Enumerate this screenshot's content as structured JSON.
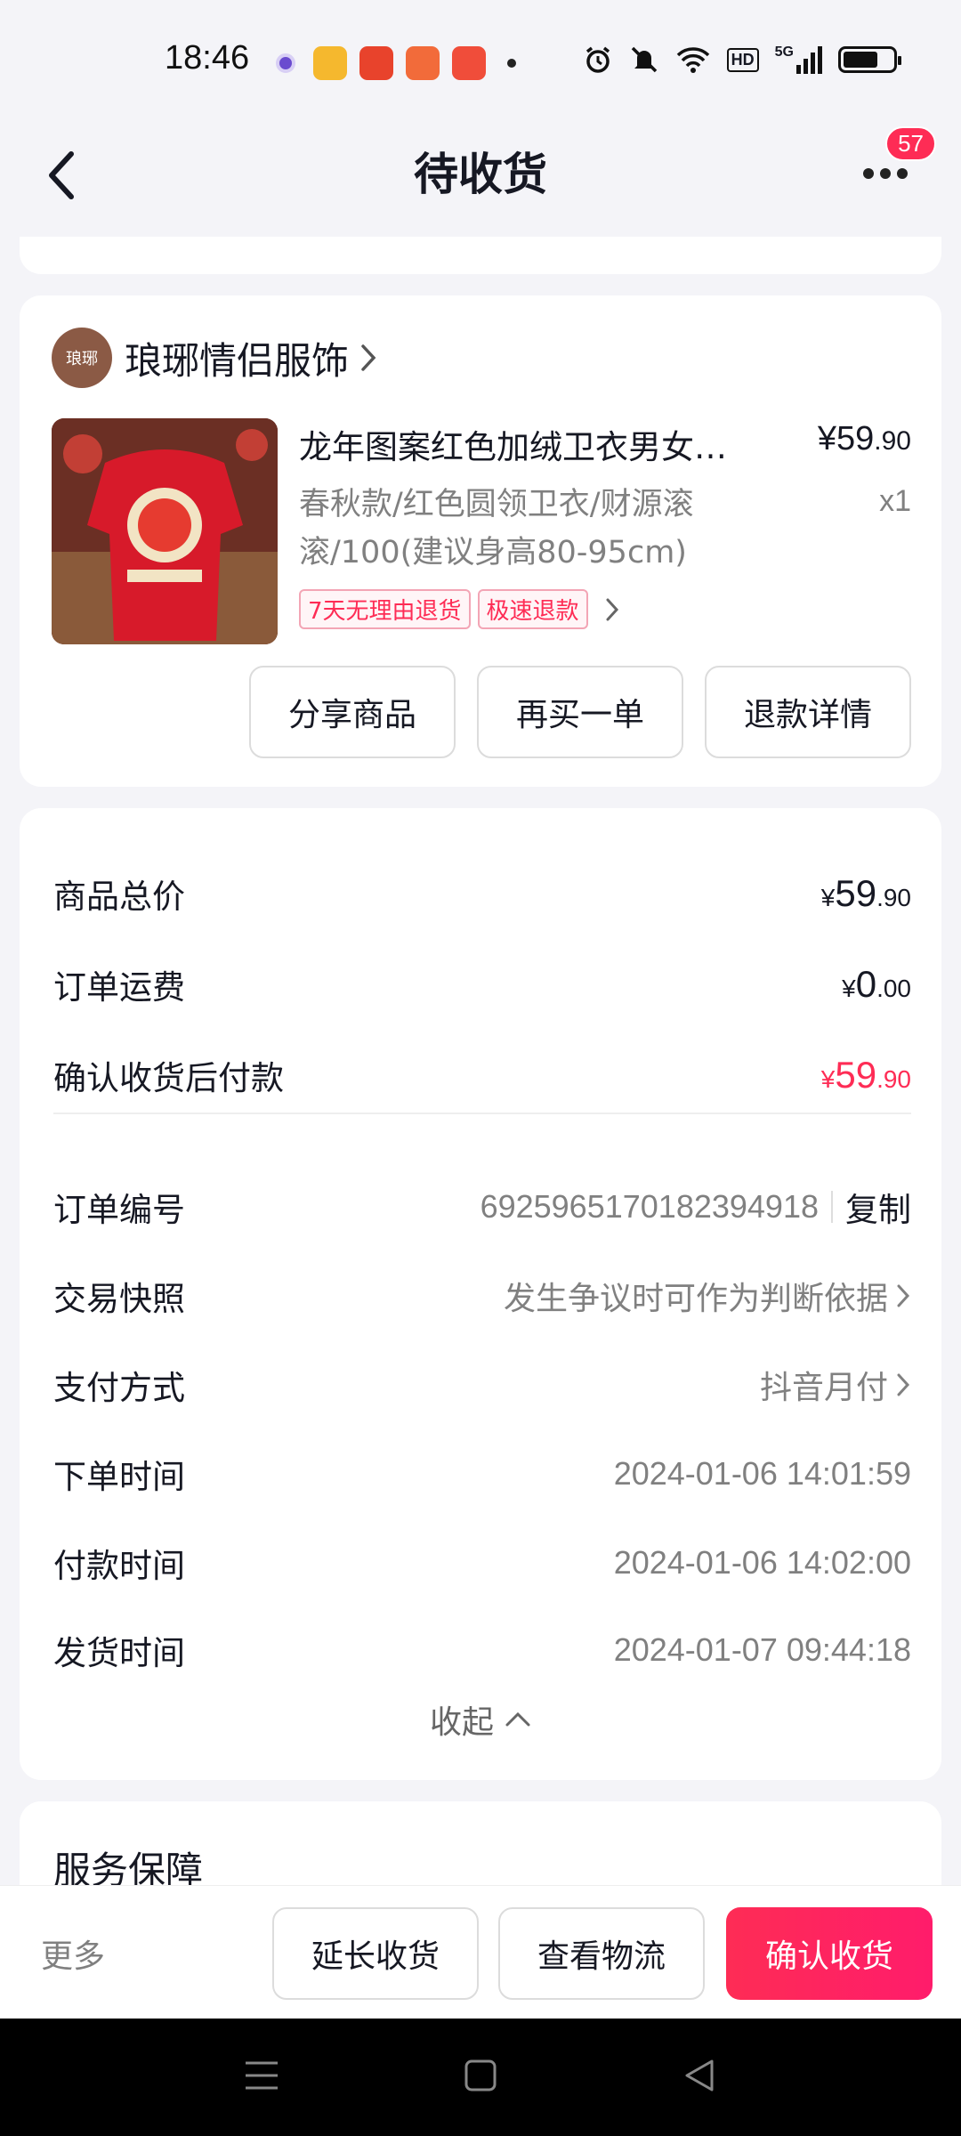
{
  "status_bar": {
    "time": "18:46",
    "network_label": "5G",
    "hd_label": "HD",
    "battery_level": 0.7
  },
  "nav": {
    "title": "待收货",
    "badge_count": "57"
  },
  "shop": {
    "logo_text": "琅琊",
    "name": "琅琊情侣服饰"
  },
  "product": {
    "title": "龙年图案红色加绒卫衣男女…",
    "price_symbol": "¥",
    "price_int": "59",
    "price_dec": ".90",
    "sku": "春秋款/红色圆领卫衣/财源滚滚/100(建议身高80-95cm)",
    "qty": "x1",
    "tags": [
      "7天无理由退货",
      "极速退款"
    ],
    "actions": [
      "分享商品",
      "再买一单",
      "退款详情"
    ]
  },
  "price_rows": [
    {
      "label": "商品总价",
      "cur": "¥",
      "int": "59",
      "dec": ".90"
    },
    {
      "label": "订单运费",
      "cur": "¥",
      "int": "0",
      "dec": ".00"
    },
    {
      "label": "确认收货后付款",
      "cur": "¥",
      "int": "59",
      "dec": ".90"
    }
  ],
  "order_info": {
    "order_no_label": "订单编号",
    "order_no": "6925965170182394918",
    "copy_label": "复制",
    "snapshot_label": "交易快照",
    "snapshot_value": "发生争议时可作为判断依据",
    "payment_label": "支付方式",
    "payment_value": "抖音月付",
    "order_time_label": "下单时间",
    "order_time": "2024-01-06 14:01:59",
    "pay_time_label": "付款时间",
    "pay_time": "2024-01-06 14:02:00",
    "ship_time_label": "发货时间",
    "ship_time": "2024-01-07 09:44:18",
    "collapse_label": "收起"
  },
  "service": {
    "title": "服务保障"
  },
  "bottom_bar": {
    "more_label": "更多",
    "extend_label": "延长收货",
    "logistics_label": "查看物流",
    "confirm_label": "确认收货"
  },
  "colors": {
    "accent": "#fe2c55",
    "background": "#f4f4f8",
    "text_primary": "#161823",
    "text_secondary": "#808080"
  }
}
